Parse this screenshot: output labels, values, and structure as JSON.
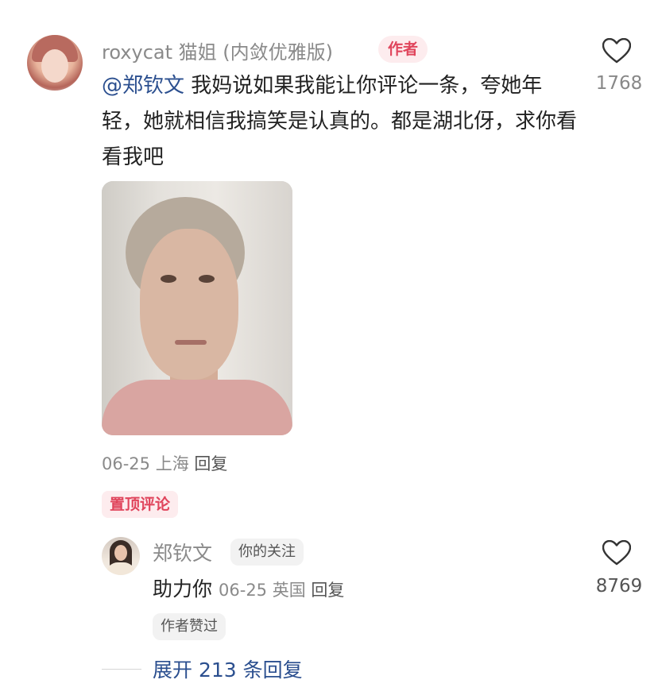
{
  "main_comment": {
    "username": "roxycat 猫姐 (内敛优雅版)",
    "author_badge": "作者",
    "mention": "@郑钦文",
    "text": " 我妈说如果我能让你评论一条，夸她年轻，她就相信我搞笑是认真的。都是湖北伢，求你看看我吧",
    "like_count": "1768",
    "date": "06-25",
    "location": "上海",
    "reply_label": "回复",
    "pinned_label": "置顶评论"
  },
  "reply_comment": {
    "username": "郑钦文",
    "follow_badge": "你的关注",
    "text": "助力你",
    "date": "06-25",
    "location": "英国",
    "reply_label": "回复",
    "like_count": "8769",
    "liked_badge": "作者赞过"
  },
  "expand": {
    "label": "展开 213 条回复"
  },
  "icons": {
    "like": "heart-outline-icon"
  },
  "colors": {
    "author_badge_bg": "#fdecee",
    "author_badge_text": "#e0455c",
    "mention": "#2b4f8f",
    "expand": "#2b4f8f"
  }
}
